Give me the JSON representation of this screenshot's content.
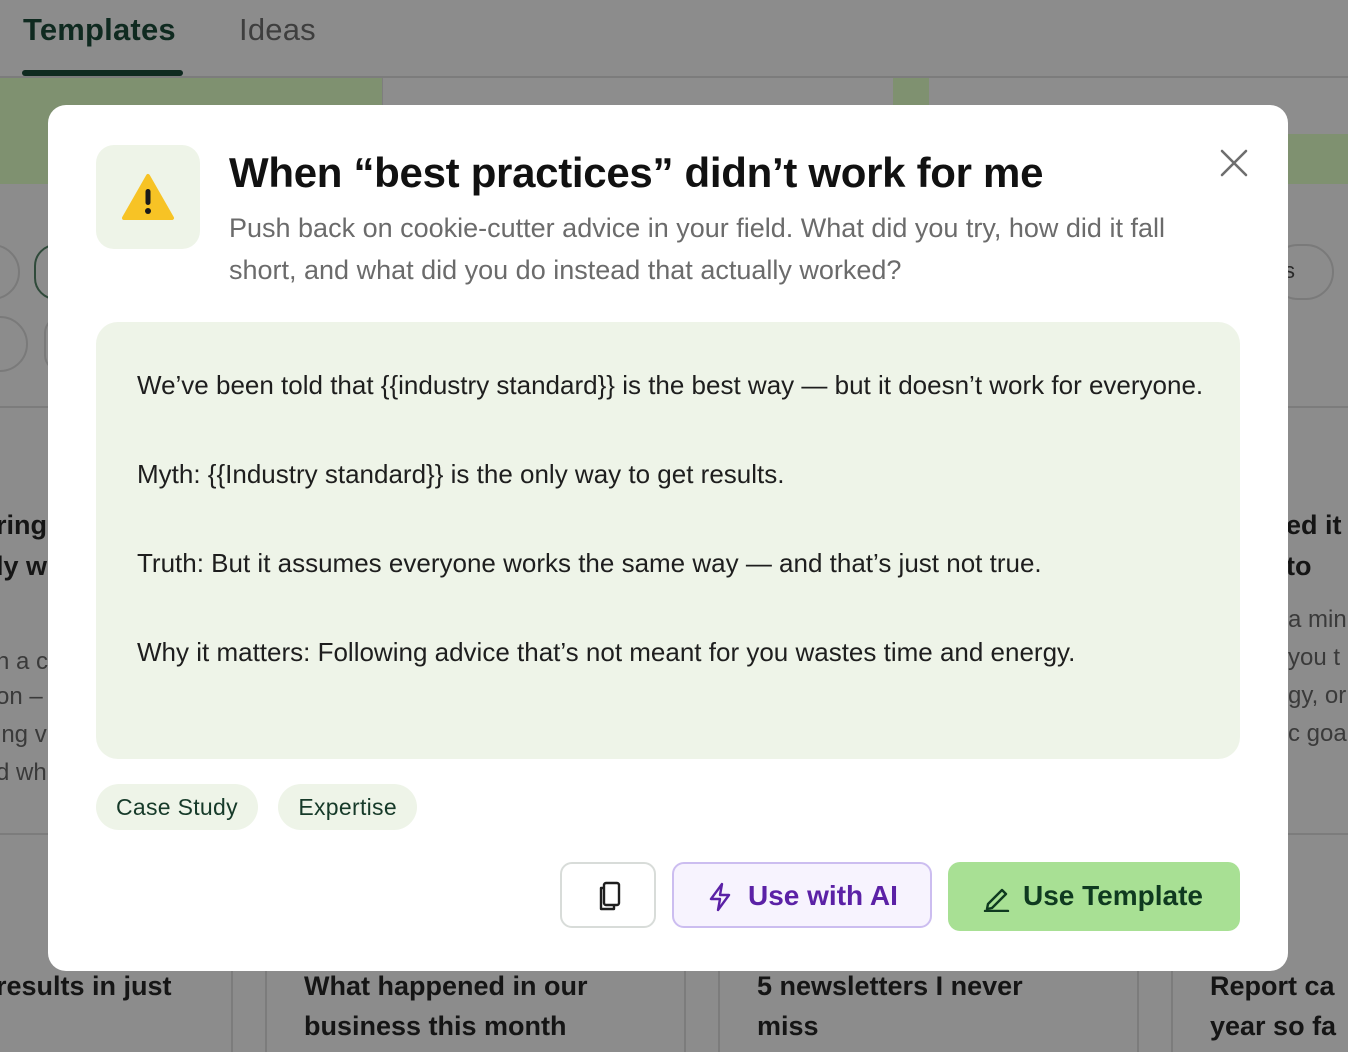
{
  "tabs": {
    "templates": "Templates",
    "ideas": "Ideas"
  },
  "background": {
    "left_card_fragments": [
      "ring",
      "ly w"
    ],
    "left_card_text": [
      "h a c",
      "on –",
      "ing v",
      "d wh"
    ],
    "right_card_fragments": [
      "ed it",
      "to"
    ],
    "right_card_text": [
      "a min",
      "you t",
      "gy, or",
      "c goa"
    ],
    "pill_fragment": "s",
    "bottom_cards": [
      {
        "line1": "results in just",
        "line2": ""
      },
      {
        "line1": "What happened in our",
        "line2": "business this month"
      },
      {
        "line1": "5 newsletters I never",
        "line2": "miss"
      },
      {
        "line1": "Report ca",
        "line2": "year so fa"
      }
    ]
  },
  "modal": {
    "icon": "warning-icon",
    "title": "When “best practices” didn’t work for me",
    "subtitle": "Push back on cookie-cutter advice in your field. What did you try, how did it fall short, and what did you do instead that actually worked?",
    "paragraphs": [
      "We’ve been told that {{industry standard}} is the best way — but it doesn’t work for everyone.",
      "Myth: {{Industry standard}} is the only way to get results.",
      "Truth: But it assumes everyone works the same way — and that’s just not true.",
      "Why it matters: Following advice that’s not meant for you wastes time and energy."
    ],
    "tags": [
      "Case Study",
      "Expertise"
    ],
    "buttons": {
      "copy_icon": "copy-icon",
      "ai_label": "Use with AI",
      "use_label": "Use Template"
    }
  },
  "colors": {
    "overlay": "#8c8c8c",
    "accent_green": "#a8e094",
    "content_bg": "#eef4e8",
    "ai_purple": "#5b21a6"
  }
}
